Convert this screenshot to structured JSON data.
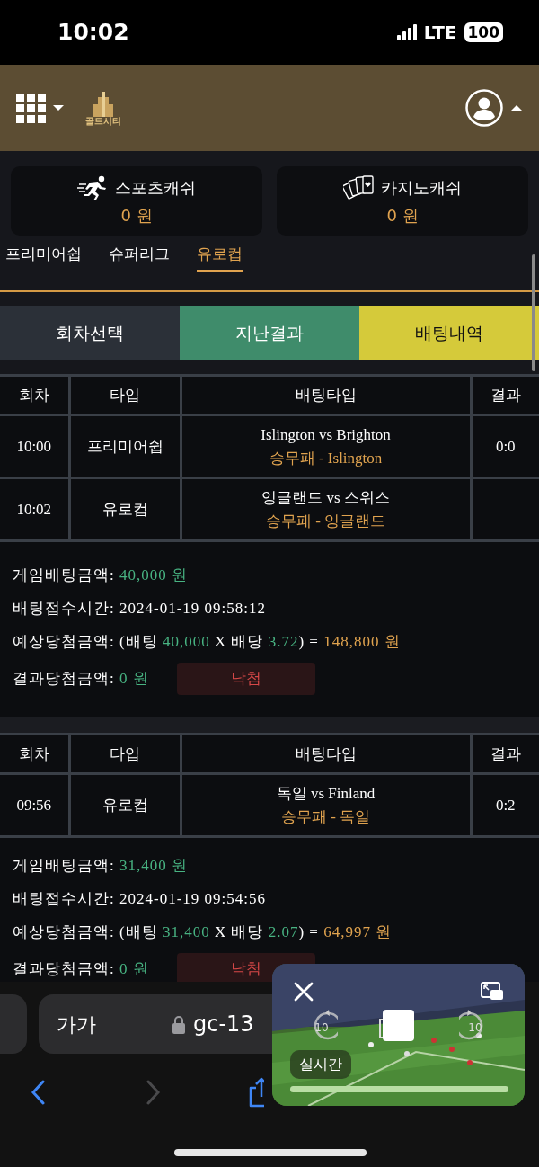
{
  "status_bar": {
    "time": "10:02",
    "network": "LTE",
    "battery": "100"
  },
  "header": {
    "logo_text": "골드시티"
  },
  "wallets": [
    {
      "kind": "sports",
      "label": "스포츠캐쉬",
      "amount": "0 원"
    },
    {
      "kind": "casino",
      "label": "카지노캐쉬",
      "amount": "0 원"
    }
  ],
  "league_tabs": [
    {
      "label": "프리미어쉽",
      "selected": false
    },
    {
      "label": "슈퍼리그",
      "selected": false
    },
    {
      "label": "유로컵",
      "selected": true
    }
  ],
  "view_buttons": [
    {
      "label": "회차선택",
      "color": "#2b3038"
    },
    {
      "label": "지난결과",
      "color": "#3f8c6b"
    },
    {
      "label": "배팅내역",
      "color": "#d5ca3a"
    }
  ],
  "bets": [
    {
      "columns": [
        "회차",
        "타입",
        "배팅타입",
        "결과"
      ],
      "rows": [
        {
          "round": "10:00",
          "type": "프리미어쉽",
          "match": "Islington vs Brighton",
          "pick": "승무패 - Islington",
          "result": "0:0"
        },
        {
          "round": "10:02",
          "type": "유로컵",
          "match": "잉글랜드 vs 스위스",
          "pick": "승무패 - 잉글랜드"
        }
      ],
      "summary": [
        {
          "kind": "text",
          "segments": [
            {
              "text": "게임배팅금액: "
            },
            {
              "text": "40,000 원",
              "color": "#48b382"
            }
          ]
        },
        {
          "kind": "text",
          "segments": [
            {
              "text": "배팅접수시간: 2024-01-19 09:58:12"
            }
          ]
        },
        {
          "kind": "text",
          "segments": [
            {
              "text": "예상당첨금액: (배팅 "
            },
            {
              "text": "40,000",
              "color": "#48b382"
            },
            {
              "text": " X 배당 "
            },
            {
              "text": "3.72",
              "color": "#48b382"
            },
            {
              "text": ") = "
            },
            {
              "text": "148,800 원",
              "color": "#e0a34f"
            }
          ]
        },
        {
          "kind": "result",
          "segments": [
            {
              "text": "결과당첨금액: "
            },
            {
              "text": "0 원",
              "color": "#48b382"
            }
          ],
          "status": "낙첨"
        }
      ]
    },
    {
      "columns": [
        "회차",
        "타입",
        "배팅타입",
        "결과"
      ],
      "rows": [
        {
          "round": "09:56",
          "type": "유로컵",
          "match": "독일 vs Finland",
          "pick": "승무패 - 독일",
          "result": "0:2"
        }
      ],
      "summary": [
        {
          "kind": "text",
          "segments": [
            {
              "text": "게임배팅금액: "
            },
            {
              "text": "31,400 원",
              "color": "#48b382"
            }
          ]
        },
        {
          "kind": "text",
          "segments": [
            {
              "text": "배팅접수시간: 2024-01-19 09:54:56"
            }
          ]
        },
        {
          "kind": "text",
          "segments": [
            {
              "text": "예상당첨금액: (배팅 "
            },
            {
              "text": "31,400",
              "color": "#48b382"
            },
            {
              "text": " X 배당 "
            },
            {
              "text": "2.07",
              "color": "#48b382"
            },
            {
              "text": ") = "
            },
            {
              "text": "64,997 원",
              "color": "#e0a34f"
            }
          ]
        },
        {
          "kind": "result",
          "segments": [
            {
              "text": "결과당첨금액: "
            },
            {
              "text": "0 원",
              "color": "#48b382"
            }
          ],
          "status": "낙첨"
        }
      ]
    }
  ],
  "browser": {
    "text_size_button": "가가",
    "url": "gc-13"
  },
  "video_pip": {
    "rewind": "10",
    "forward": "10",
    "live_label": "실시간",
    "level": 1
  }
}
